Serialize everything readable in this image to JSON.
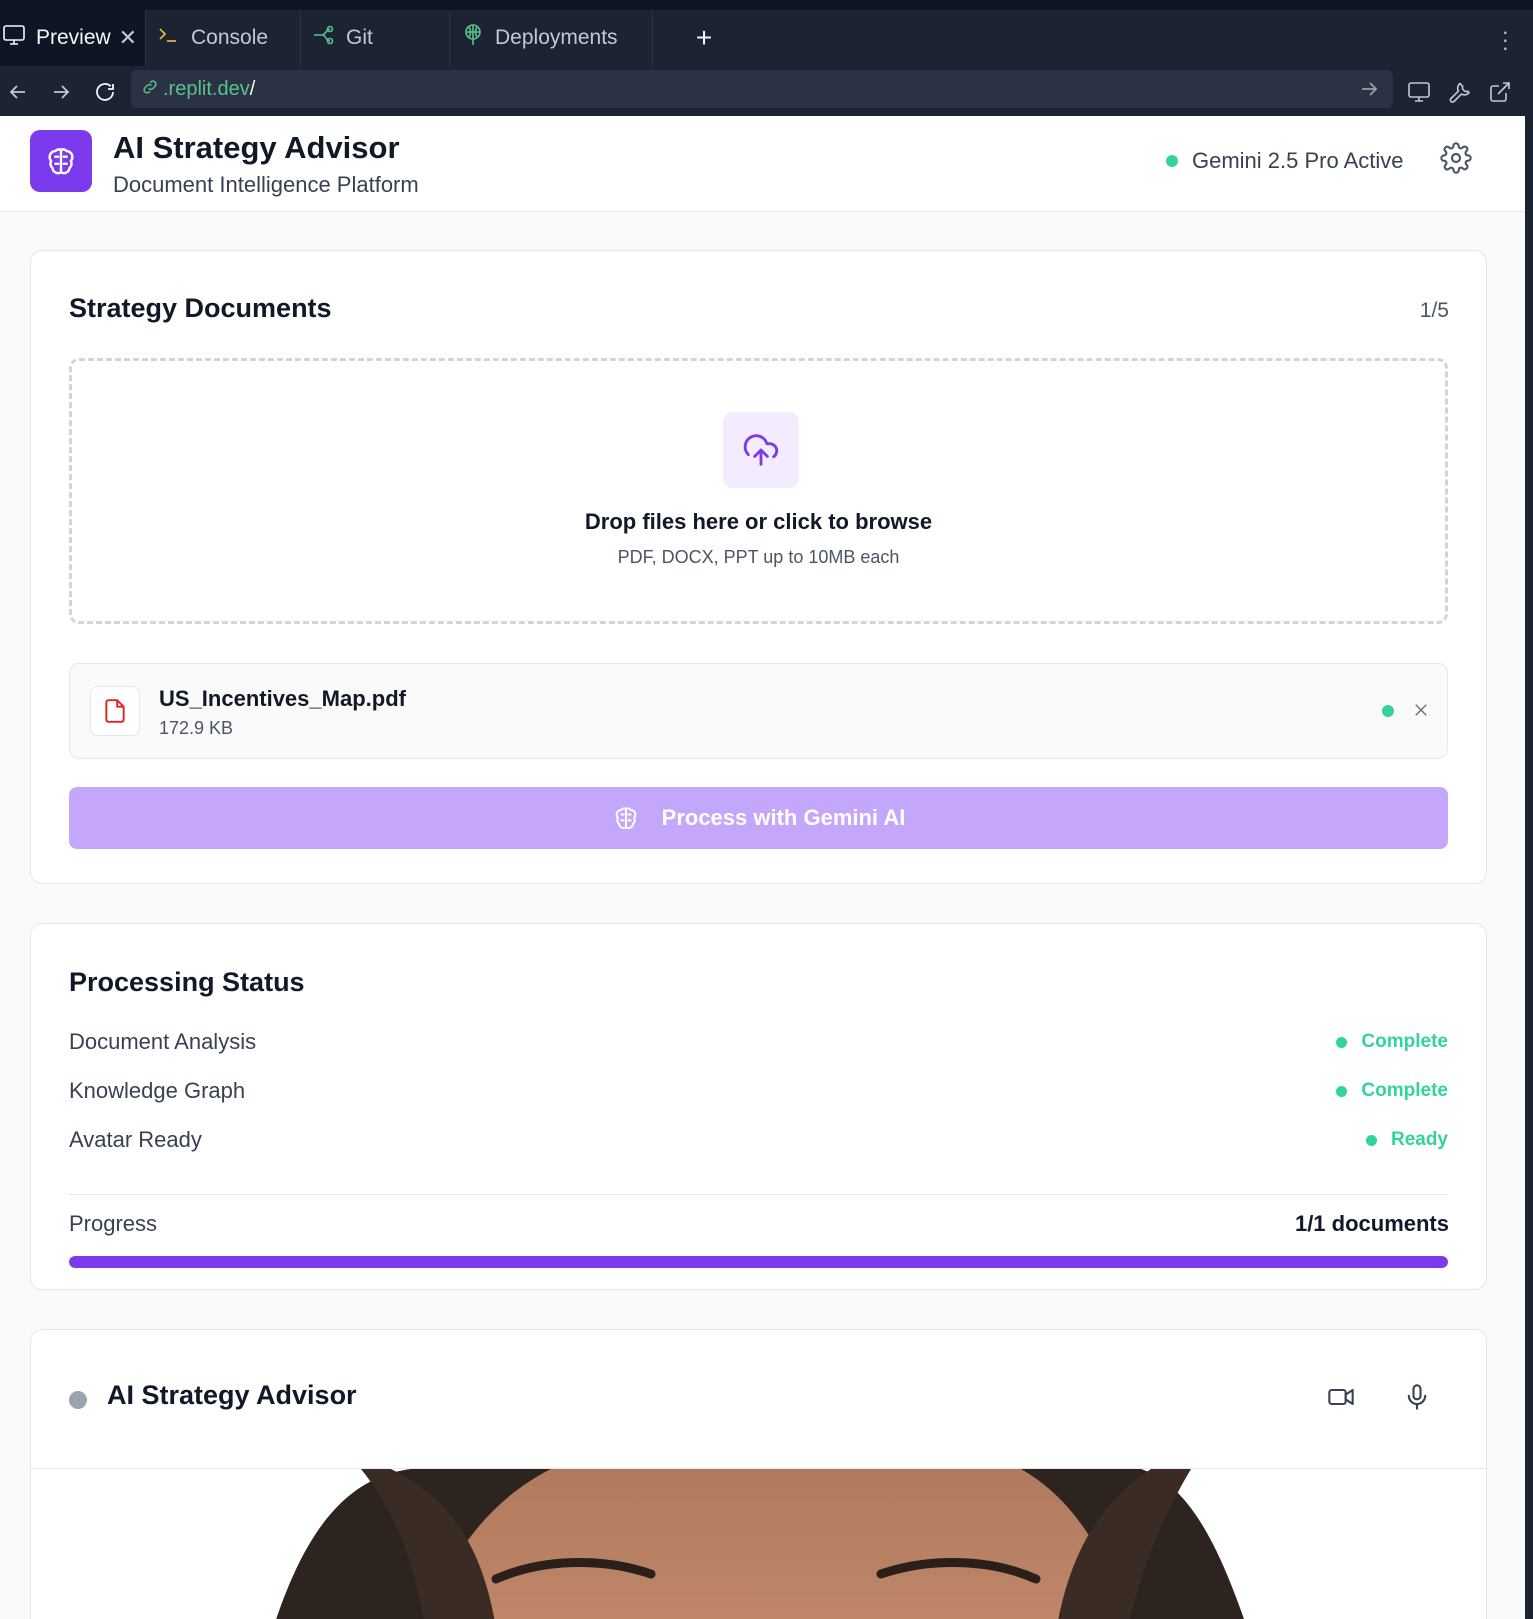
{
  "ide": {
    "tabs": [
      {
        "label": "Preview",
        "icon": "monitor-icon"
      },
      {
        "label": "Console",
        "icon": "terminal-icon"
      },
      {
        "label": "Git",
        "icon": "git-icon"
      },
      {
        "label": "Deployments",
        "icon": "deployments-icon"
      }
    ],
    "new_tab": "+",
    "url_host": ".replit.dev",
    "url_path": "/"
  },
  "app": {
    "title": "AI Strategy Advisor",
    "subtitle": "Document Intelligence Platform",
    "model_status": "Gemini 2.5 Pro Active",
    "accent_color": "#7c3aed",
    "success_color": "#34d399"
  },
  "documents": {
    "title": "Strategy Documents",
    "count": "1/5",
    "dropzone_title": "Drop files here or click to browse",
    "dropzone_hint": "PDF, DOCX, PPT up to 10MB each",
    "files": [
      {
        "name": "US_Incentives_Map.pdf",
        "size": "172.9 KB"
      }
    ],
    "process_button": "Process with Gemini AI"
  },
  "status": {
    "title": "Processing Status",
    "rows": [
      {
        "label": "Document Analysis",
        "value": "Complete"
      },
      {
        "label": "Knowledge Graph",
        "value": "Complete"
      },
      {
        "label": "Avatar Ready",
        "value": "Ready"
      }
    ],
    "progress_label": "Progress",
    "progress_value": "1/1 documents",
    "progress_fraction": 1.0
  },
  "advisor": {
    "title": "AI Strategy Advisor"
  }
}
